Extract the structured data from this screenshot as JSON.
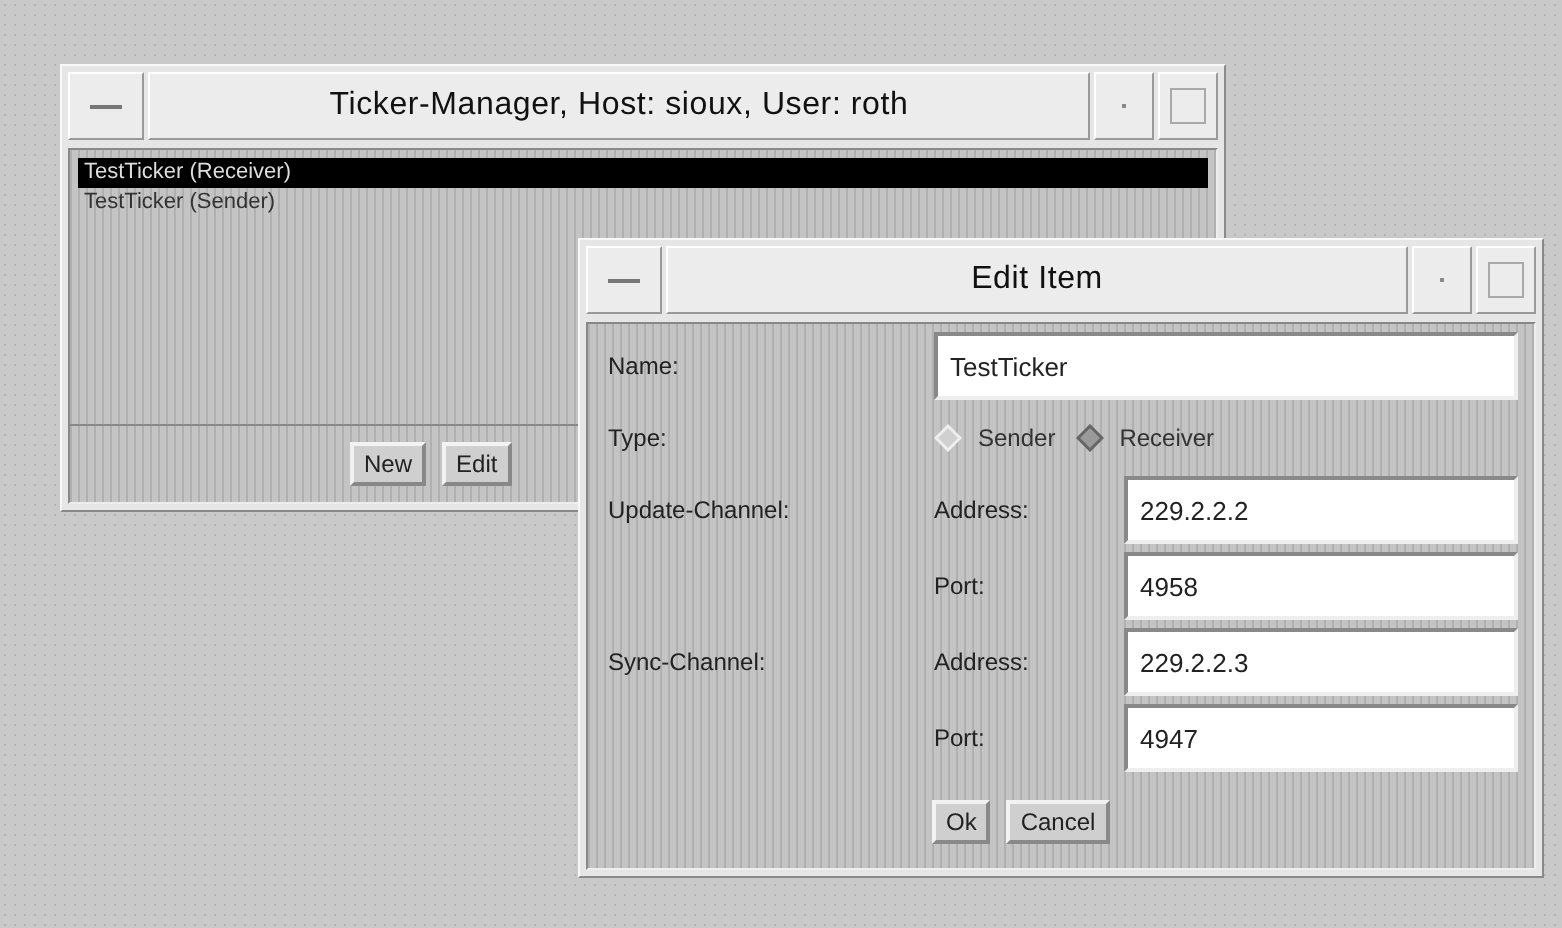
{
  "manager": {
    "title": "Ticker-Manager, Host: sioux, User: roth",
    "items": [
      {
        "label": "TestTicker (Receiver)",
        "selected": true
      },
      {
        "label": "TestTicker (Sender)",
        "selected": false
      }
    ],
    "buttons": [
      "New",
      "Edit"
    ]
  },
  "editor": {
    "title": "Edit Item",
    "name_label": "Name:",
    "name_value": "TestTicker",
    "type_label": "Type:",
    "types": [
      {
        "label": "Sender",
        "selected": false
      },
      {
        "label": "Receiver",
        "selected": true
      }
    ],
    "channels": [
      {
        "label": "Update-Channel:",
        "address_label": "Address:",
        "address": "229.2.2.2",
        "port_label": "Port:",
        "port": "4958"
      },
      {
        "label": "Sync-Channel:",
        "address_label": "Address:",
        "address": "229.2.2.3",
        "port_label": "Port:",
        "port": "4947"
      }
    ],
    "buttons": [
      "Ok",
      "Cancel"
    ]
  }
}
